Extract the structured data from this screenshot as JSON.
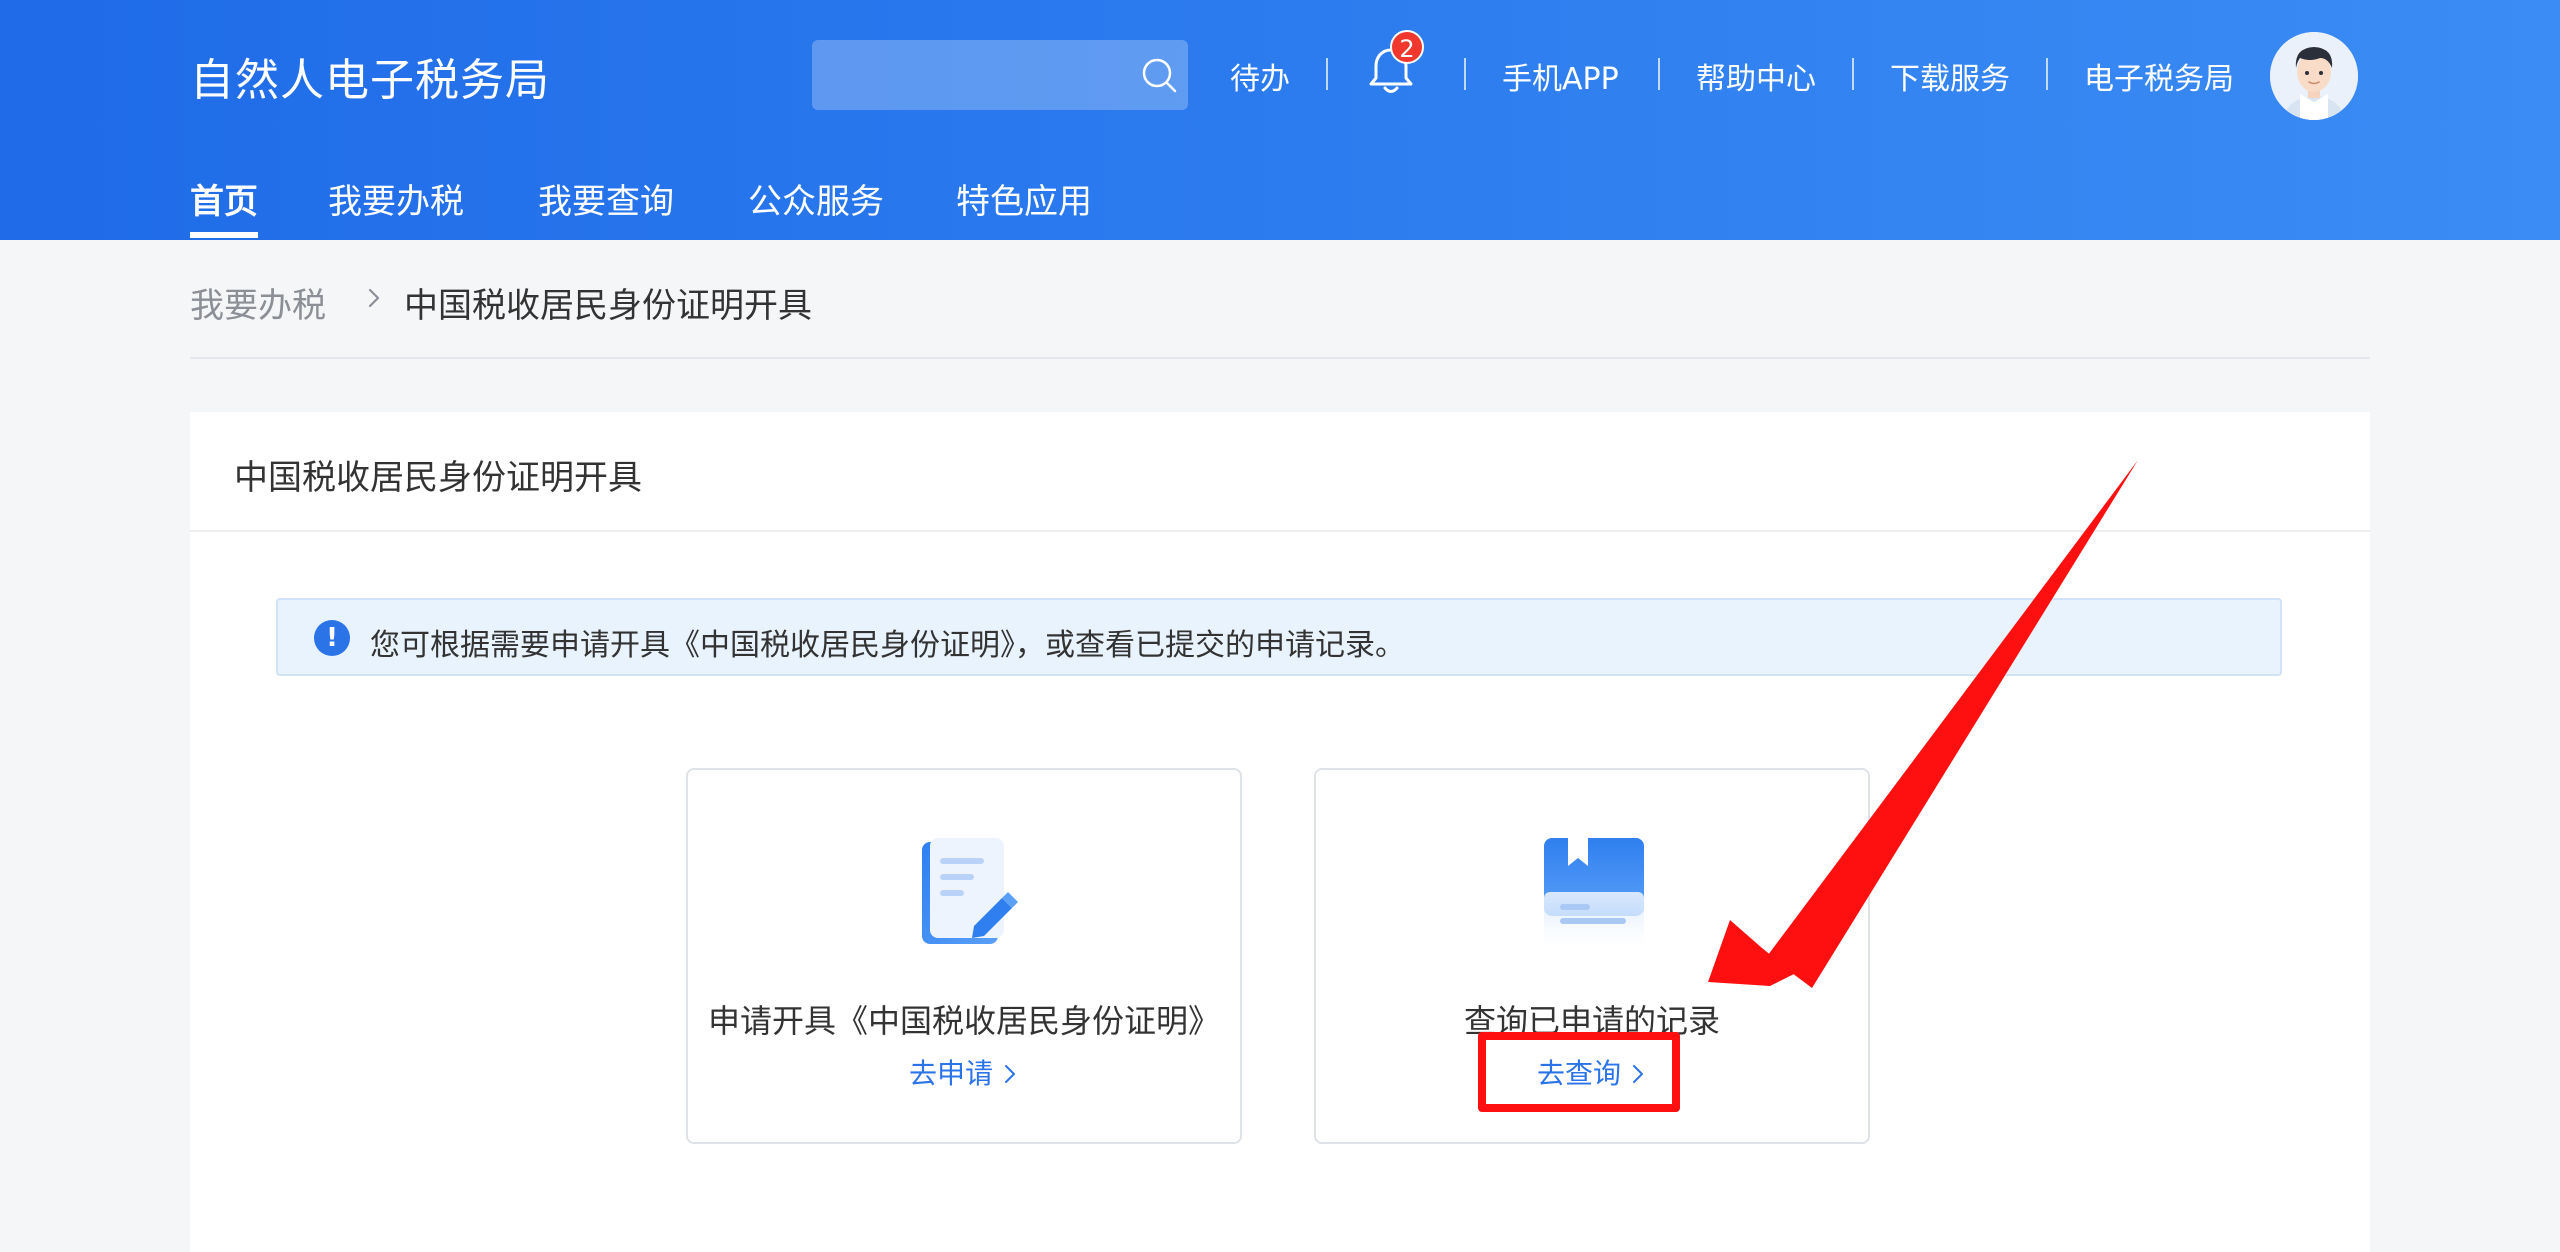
{
  "header": {
    "brand": "自然人电子税务局",
    "search": {
      "placeholder": ""
    },
    "links": {
      "todo": "待办",
      "mobile_app": "手机APP",
      "help_center": "帮助中心",
      "download": "下载服务",
      "etax_bureau": "电子税务局"
    },
    "notification_count": "2"
  },
  "nav": {
    "items": [
      "首页",
      "我要办税",
      "我要查询",
      "公众服务",
      "特色应用"
    ],
    "active_index": 0
  },
  "breadcrumb": {
    "parent": "我要办税",
    "current": "中国税收居民身份证明开具"
  },
  "panel": {
    "title": "中国税收居民身份证明开具",
    "notice": "您可根据需要申请开具《中国税收居民身份证明》，或查看已提交的申请记录。",
    "cards": [
      {
        "title": "申请开具《中国税收居民身份证明》",
        "link": "去申请",
        "icon": "document-edit-icon"
      },
      {
        "title": "查询已申请的记录",
        "link": "去查询",
        "icon": "record-book-icon"
      }
    ]
  },
  "colors": {
    "header_blue": "#2f7ff0",
    "link_blue": "#2b74e8",
    "annotation_red": "#ff1010"
  }
}
